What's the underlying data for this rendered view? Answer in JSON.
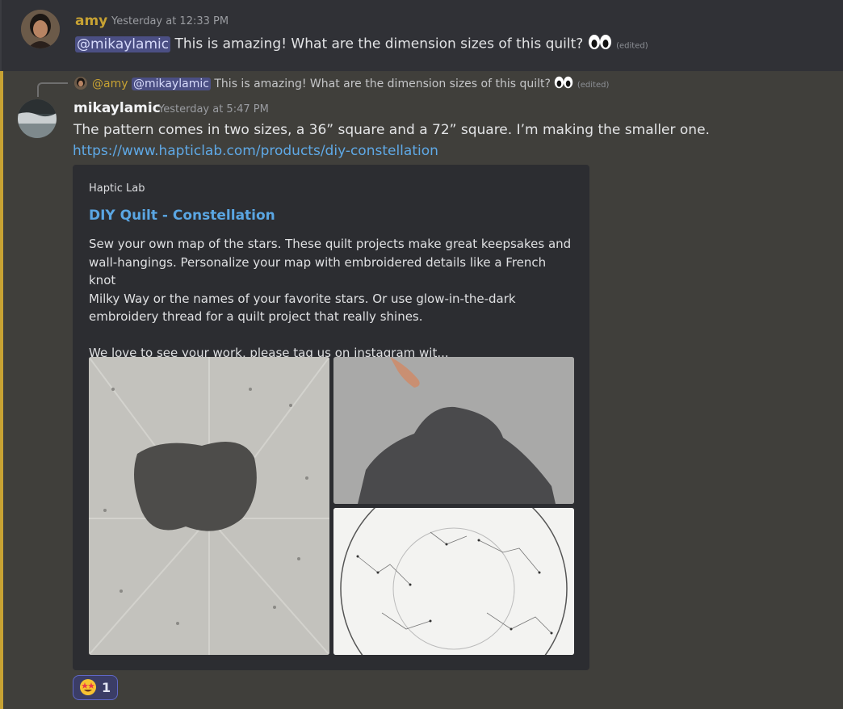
{
  "message1": {
    "author": "amy",
    "author_color": "#c7a233",
    "timestamp": "Yesterday at 12:33 PM",
    "mention": "@mikaylamic",
    "text": "This is amazing! What are the dimension sizes of this quilt?",
    "emoji": "eyes-emoji",
    "edited": "(edited)"
  },
  "reply_preview": {
    "author": "@amy",
    "mention": "@mikaylamic",
    "text": "This is amazing! What are the dimension sizes of this quilt?",
    "edited": "(edited)"
  },
  "message2": {
    "author": "mikaylamic",
    "timestamp": "Yesterday at 5:47 PM",
    "text": "The pattern comes in two sizes, a 36” square and a 72” square. I’m making the smaller one.",
    "link": "https://www.hapticlab.com/products/diy-constellation"
  },
  "embed": {
    "provider": "Haptic Lab",
    "title": "DIY Quilt - Constellation",
    "description": "Sew your own map of the stars. These quilt projects make great keepsakes and\nwall-hangings. Personalize your map with embroidered details like a French knot\nMilky Way or the names of your favorite stars. Or use glow-in-the-dark\nembroidery thread for a quilt project that really shines.\n\nWe love to see your work, please tag us on instagram wit..."
  },
  "reaction": {
    "emoji": "star-struck-emoji",
    "count": "1"
  },
  "colors": {
    "highlight_bar": "#c7a233",
    "link": "#5fa9e6",
    "mention_bg": "#4b4f84"
  }
}
